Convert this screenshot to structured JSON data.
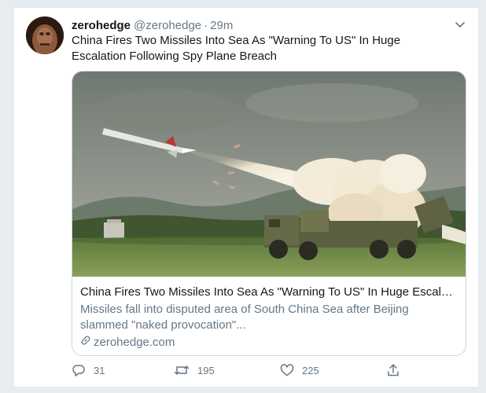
{
  "tweet": {
    "author_name": "zerohedge",
    "author_handle": "@zerohedge",
    "separator": "·",
    "time": "29m",
    "text": "China Fires Two Missiles Into Sea As \"Warning To US\" In Huge Escalation Following Spy Plane Breach"
  },
  "link_card": {
    "title": "China Fires Two Missiles Into Sea As \"Warning To US\" In Huge Escalatio...",
    "description": "Missiles fall into disputed area of South China Sea after Beijing slammed \"naked provocation\"...",
    "domain": "zerohedge.com"
  },
  "actions": {
    "replies": "31",
    "retweets": "195",
    "likes": "225"
  },
  "icons": {
    "menu": "chevron-down-icon",
    "reply": "reply-icon",
    "retweet": "retweet-icon",
    "like": "heart-icon",
    "share": "share-icon",
    "link": "link-icon"
  },
  "colors": {
    "secondary_text": "#657786",
    "border": "#ccd6dd",
    "background": "#e6ecf0"
  }
}
